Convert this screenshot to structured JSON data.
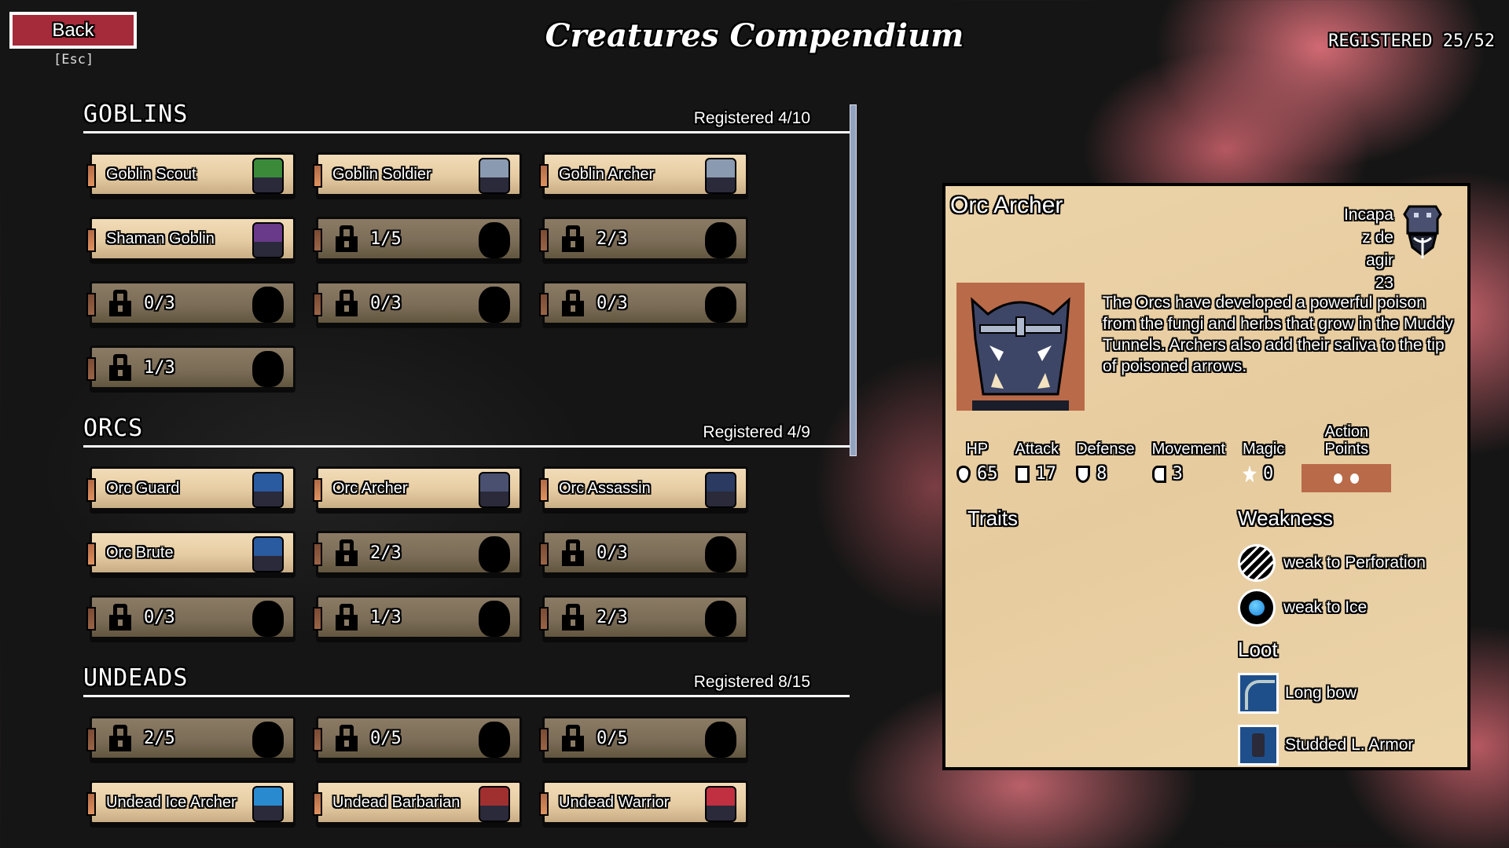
{
  "header": {
    "back_label": "Back",
    "back_hint": "[Esc]",
    "title": "Creatures Compendium",
    "registered_total": "REGISTERED 25/52"
  },
  "categories": [
    {
      "name": "GOBLINS",
      "registered": "Registered 4/10",
      "cards": [
        {
          "label": "Goblin Scout",
          "unlocked": true,
          "sprite_color": "#3a8a3a"
        },
        {
          "label": "Goblin Soldier",
          "unlocked": true,
          "sprite_color": "#8a9ab0"
        },
        {
          "label": "Goblin Archer",
          "unlocked": true,
          "sprite_color": "#8a9ab0"
        },
        {
          "label": "Shaman Goblin",
          "unlocked": true,
          "sprite_color": "#6a3a8a"
        },
        {
          "label": "1/5",
          "unlocked": false
        },
        {
          "label": "2/3",
          "unlocked": false
        },
        {
          "label": "0/3",
          "unlocked": false
        },
        {
          "label": "0/3",
          "unlocked": false
        },
        {
          "label": "0/3",
          "unlocked": false
        },
        {
          "label": "1/3",
          "unlocked": false
        }
      ]
    },
    {
      "name": "ORCS",
      "registered": "Registered 4/9",
      "cards": [
        {
          "label": "Orc Guard",
          "unlocked": true,
          "sprite_color": "#2a5aa0"
        },
        {
          "label": "Orc Archer",
          "unlocked": true,
          "sprite_color": "#4a5070"
        },
        {
          "label": "Orc Assassin",
          "unlocked": true,
          "sprite_color": "#2a3a60"
        },
        {
          "label": "Orc Brute",
          "unlocked": true,
          "sprite_color": "#2a5aa0"
        },
        {
          "label": "2/3",
          "unlocked": false
        },
        {
          "label": "0/3",
          "unlocked": false
        },
        {
          "label": "0/3",
          "unlocked": false
        },
        {
          "label": "1/3",
          "unlocked": false
        },
        {
          "label": "2/3",
          "unlocked": false
        }
      ]
    },
    {
      "name": "UNDEADS",
      "registered": "Registered 8/15",
      "cards": [
        {
          "label": "2/5",
          "unlocked": false
        },
        {
          "label": "0/5",
          "unlocked": false
        },
        {
          "label": "0/5",
          "unlocked": false
        },
        {
          "label": "Undead Ice Archer",
          "unlocked": true,
          "sprite_color": "#2a8ad0"
        },
        {
          "label": "Undead Barbarian",
          "unlocked": true,
          "sprite_color": "#a03030"
        },
        {
          "label": "Undead Warrior",
          "unlocked": true,
          "sprite_color": "#c03040"
        }
      ]
    }
  ],
  "scroll_position": 0.0,
  "detail": {
    "name": "Orc Archer",
    "status_lines": [
      "Incapa",
      "z de",
      "agir",
      "23"
    ],
    "description": "The Orcs have developed a powerful poison from the fungi and herbs that grow in the Muddy Tunnels. Archers also add their saliva to the tip of poisoned arrows.",
    "stats": [
      {
        "label": "HP",
        "value": "65",
        "icon": "heart-icon"
      },
      {
        "label": "Attack",
        "value": "17",
        "icon": "boot-icon"
      },
      {
        "label": "Defense",
        "value": "8",
        "icon": "shield-icon"
      },
      {
        "label": "Movement",
        "value": "3",
        "icon": "movement-icon"
      },
      {
        "label": "Magic",
        "value": "0",
        "icon": "star-icon"
      }
    ],
    "action_points_label": "Action Points",
    "action_points": 2,
    "traits_title": "Traits",
    "weakness_title": "Weakness",
    "weaknesses": [
      {
        "label": "weak to Perforation",
        "icon": "perforation-icon"
      },
      {
        "label": "weak to Ice",
        "icon": "ice-icon"
      }
    ],
    "loot_title": "Loot",
    "loot": [
      {
        "label": "Long bow",
        "icon": "bow-icon"
      },
      {
        "label": "Studded L. Armor",
        "icon": "armor-icon"
      }
    ]
  },
  "colors": {
    "back_button": "#a52a3a",
    "parchment": "#e6cb9e",
    "scrollbar": "#92a3be",
    "portrait_bg": "#b96a48"
  }
}
